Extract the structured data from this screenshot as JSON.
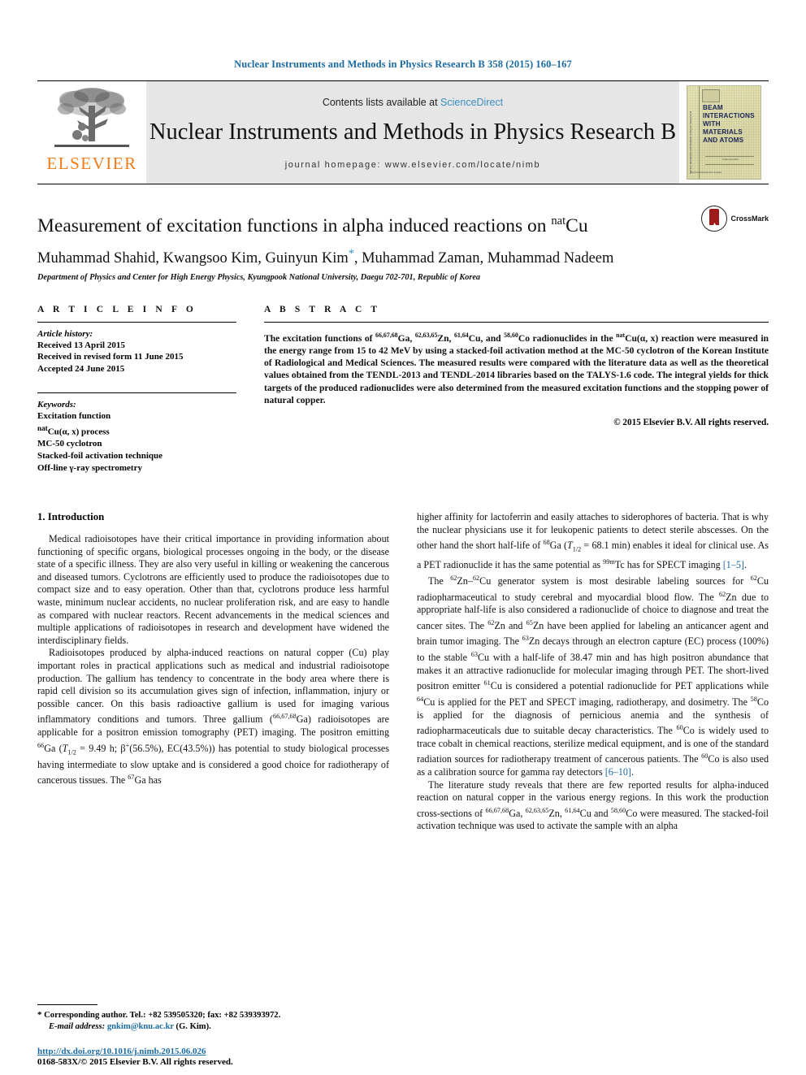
{
  "running_head": "Nuclear Instruments and Methods in Physics Research B 358 (2015) 160–167",
  "masthead": {
    "publisher": "ELSEVIER",
    "contents_prefix": "Contents lists available at ",
    "sciencedirect": "ScienceDirect",
    "journal_title": "Nuclear Instruments and Methods in Physics Research B",
    "homepage": "journal homepage: www.elsevier.com/locate/nimb",
    "cover": {
      "line1": "BEAM",
      "line2": "INTERACTIONS",
      "line3": "WITH",
      "line4": "MATERIALS",
      "line5": "AND ATOMS",
      "side_text": "Nuclear Instruments and Methods in Physics Research B",
      "footer_small": "Editor-in-Chief",
      "footer_small2": "Elsevier International Journal"
    }
  },
  "article": {
    "title_main": "Measurement of excitation functions in alpha induced reactions on ",
    "title_sup": "nat",
    "title_tail": "Cu",
    "crossmark_label": "CrossMark",
    "authors": "Muhammad Shahid, Kwangsoo Kim, Guinyun Kim",
    "authors_tail": ", Muhammad Zaman, Muhammad Nadeem",
    "corresponding_star": "*",
    "affiliation": "Department of Physics and Center for High Energy Physics, Kyungpook National University, Daegu 702-701, Republic of Korea"
  },
  "article_info": {
    "section_label": "A R T I C L E   I N F O",
    "history_label": "Article history:",
    "history": [
      "Received 13 April 2015",
      "Received in revised form 11 June 2015",
      "Accepted 24 June 2015"
    ],
    "keywords_label": "Keywords:",
    "keywords": [
      "Excitation function",
      "natCu(α, x) process",
      "MC-50 cyclotron",
      "Stacked-foil activation technique",
      "Off-line γ-ray spectrometry"
    ]
  },
  "abstract": {
    "section_label": "A B S T R A C T",
    "copyright": "© 2015 Elsevier B.V. All rights reserved."
  },
  "body": {
    "section1_heading": "1. Introduction",
    "footnote_star": "*",
    "footnote_corresponding": " Corresponding author. Tel.: +82 539505320; fax: +82 539393972.",
    "footnote_email_label": "E-mail address:",
    "footnote_email": "gnkim@knu.ac.kr",
    "footnote_email_owner": " (G. Kim).",
    "doi": "http://dx.doi.org/10.1016/j.nimb.2015.06.026",
    "issn": "0168-583X/© 2015 Elsevier B.V. All rights reserved."
  },
  "colors": {
    "link_blue": "#1b6ba3",
    "elsevier_orange": "#f07c16",
    "sciencedirect_blue": "#3a8fc0",
    "masthead_gray": "#e6e6e6",
    "crossmark_red": "#9e1b1b"
  }
}
